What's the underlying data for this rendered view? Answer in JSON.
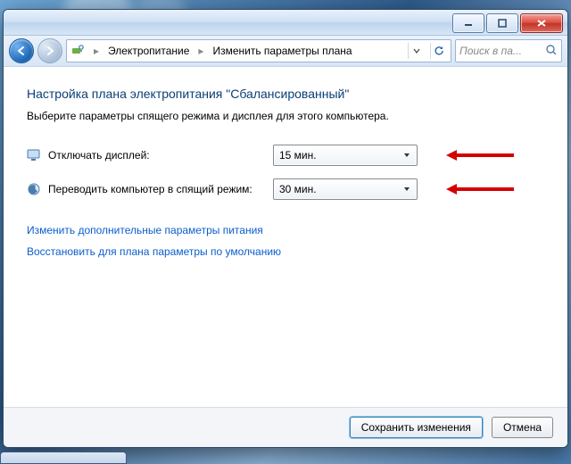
{
  "breadcrumb": {
    "item1": "Электропитание",
    "item2": "Изменить параметры плана"
  },
  "search": {
    "placeholder": "Поиск в па..."
  },
  "page": {
    "title": "Настройка плана электропитания \"Сбалансированный\"",
    "subtitle": "Выберите параметры спящего режима и дисплея для этого компьютера."
  },
  "settings": {
    "display_off_label": "Отключать дисплей:",
    "display_off_value": "15 мин.",
    "sleep_label": "Переводить компьютер в спящий режим:",
    "sleep_value": "30 мин."
  },
  "links": {
    "advanced": "Изменить дополнительные параметры питания",
    "restore": "Восстановить для плана параметры по умолчанию"
  },
  "buttons": {
    "save": "Сохранить изменения",
    "cancel": "Отмена"
  },
  "colors": {
    "accent": "#0a3e74",
    "link": "#0a5ecb",
    "arrow": "#d40000"
  }
}
